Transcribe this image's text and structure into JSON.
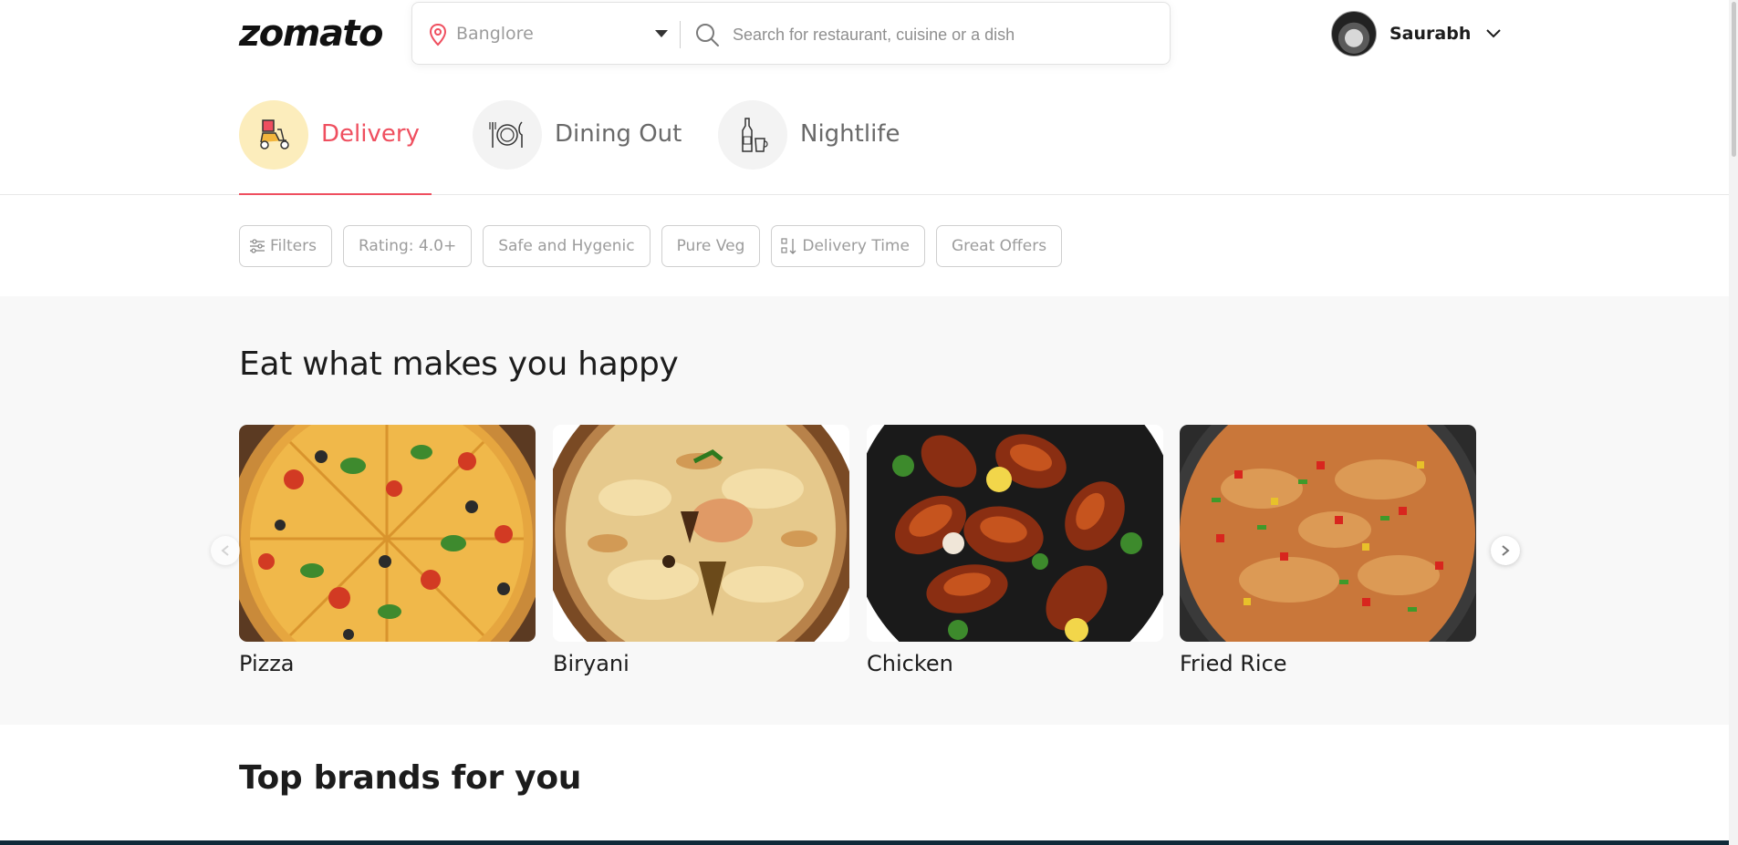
{
  "header": {
    "logo": "zomato",
    "location": "Banglore",
    "search_placeholder": "Search for restaurant, cuisine or a dish",
    "user_name": "Saurabh"
  },
  "tabs": [
    {
      "label": "Delivery",
      "icon": "scooter-icon",
      "active": true
    },
    {
      "label": "Dining Out",
      "icon": "plate-cutlery-icon",
      "active": false
    },
    {
      "label": "Nightlife",
      "icon": "bottle-glass-icon",
      "active": false
    }
  ],
  "filters": [
    {
      "label": "Filters",
      "icon": "sliders-icon"
    },
    {
      "label": "Rating: 4.0+"
    },
    {
      "label": "Safe and Hygenic"
    },
    {
      "label": "Pure Veg"
    },
    {
      "label": "Delivery Time",
      "icon": "sort-icon"
    },
    {
      "label": "Great Offers"
    }
  ],
  "collection": {
    "title": "Eat what makes you happy",
    "items": [
      {
        "name": "Pizza"
      },
      {
        "name": "Biryani"
      },
      {
        "name": "Chicken"
      },
      {
        "name": "Fried Rice"
      }
    ]
  },
  "brands": {
    "title": "Top brands for you"
  },
  "colors": {
    "accent": "#ef4f5f",
    "delivery_circle": "#fcedbc",
    "section_bg": "#f8f8f8"
  }
}
